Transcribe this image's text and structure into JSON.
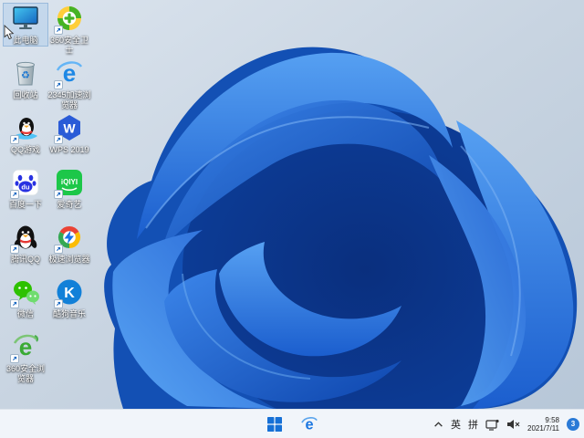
{
  "desktop": {
    "icons": [
      {
        "label": "此电脑"
      },
      {
        "label": "360安全卫士"
      },
      {
        "label": "回收站"
      },
      {
        "label": "2345加速浏览器"
      },
      {
        "label": "QQ游戏"
      },
      {
        "label": "WPS 2019"
      },
      {
        "label": "百度一下"
      },
      {
        "label": "爱奇艺"
      },
      {
        "label": "腾讯QQ"
      },
      {
        "label": "极速浏览器"
      },
      {
        "label": "微信"
      },
      {
        "label": "酷狗音乐"
      },
      {
        "label": "360安全浏览器"
      }
    ],
    "icon_glyphs": {
      "e2345": "e",
      "wps_w": "W",
      "baidu_du": "du",
      "iqiyi": "iQIYI",
      "kugou_k": "K",
      "e360": "e",
      "recycle": "♻"
    }
  },
  "taskbar": {
    "ime_en": "英",
    "ime_pinyin": "拼",
    "clock_time": "9:58",
    "clock_date": "2021/7/11",
    "badge_count": "3"
  },
  "colors": {
    "accent_blue": "#2a7ad6",
    "bloom_blue": "#1b5ece",
    "taskbar_bg": "#f1f5fa"
  }
}
